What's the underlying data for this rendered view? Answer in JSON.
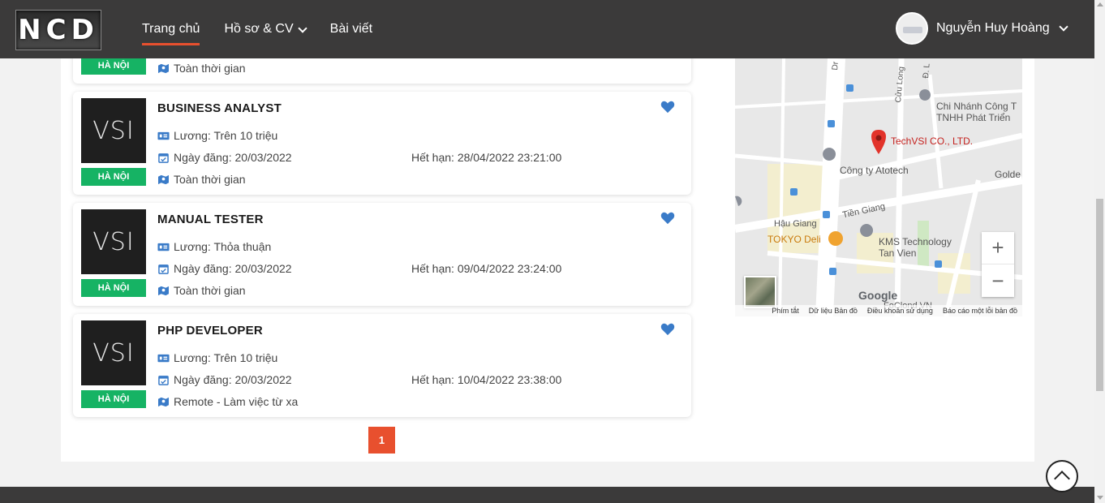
{
  "header": {
    "logo": "NCD",
    "nav": [
      "Trang chủ",
      "Hồ sơ & CV",
      "Bài viết"
    ],
    "user_name": "Nguyễn Huy Hoàng"
  },
  "partial_card": {
    "location": "HÀ NỘI",
    "work_type": "Toàn thời gian"
  },
  "jobs": [
    {
      "logo": "VSI",
      "location": "HÀ NỘI",
      "title": "BUSINESS ANALYST",
      "salary": "Lương: Trên 10 triệu",
      "posted": "Ngày đăng: 20/03/2022",
      "expires": "Hết hạn: 28/04/2022 23:21:00",
      "work_type": "Toàn thời gian"
    },
    {
      "logo": "VSI",
      "location": "HÀ NỘI",
      "title": "MANUAL TESTER",
      "salary": "Lương: Thỏa thuận",
      "posted": "Ngày đăng: 20/03/2022",
      "expires": "Hết hạn: 09/04/2022 23:24:00",
      "work_type": "Toàn thời gian"
    },
    {
      "logo": "VSI",
      "location": "HÀ NỘI",
      "title": "PHP DEVELOPER",
      "salary": "Lương: Trên 10 triệu",
      "posted": "Ngày đăng: 20/03/2022",
      "expires": "Hết hạn: 10/04/2022 23:38:00",
      "work_type": "Remote - Làm việc từ xa"
    }
  ],
  "pagination": {
    "current": "1"
  },
  "map": {
    "labels": {
      "branch_line1": "Chi Nhánh Công T",
      "branch_line2": "TNHH Phát Triển",
      "marker": "TechVSI CO., LTD.",
      "atotech": "Công ty Atotech",
      "golden": "Golde",
      "tien_giang": "Tiền Giang",
      "hau_giang": "Hậu Giang",
      "tokyo": "TOKYO Deli",
      "kms_line1": "KMS Technology",
      "kms_line2": "Tan Vien",
      "cuu_long": "Cửu Long",
      "d_l": "Đ. L",
      "dr": "Dr",
      "google": "Google",
      "foody": "FoClond VN"
    },
    "footer": [
      "Phím tắt",
      "Dữ liệu Bản đồ",
      "Điều khoản sử dụng",
      "Báo cáo một lỗi bản đồ"
    ]
  },
  "colors": {
    "accent": "#e8502e",
    "badge": "#16b364",
    "heart": "#3a7bc8",
    "header": "#3b3a3a"
  }
}
